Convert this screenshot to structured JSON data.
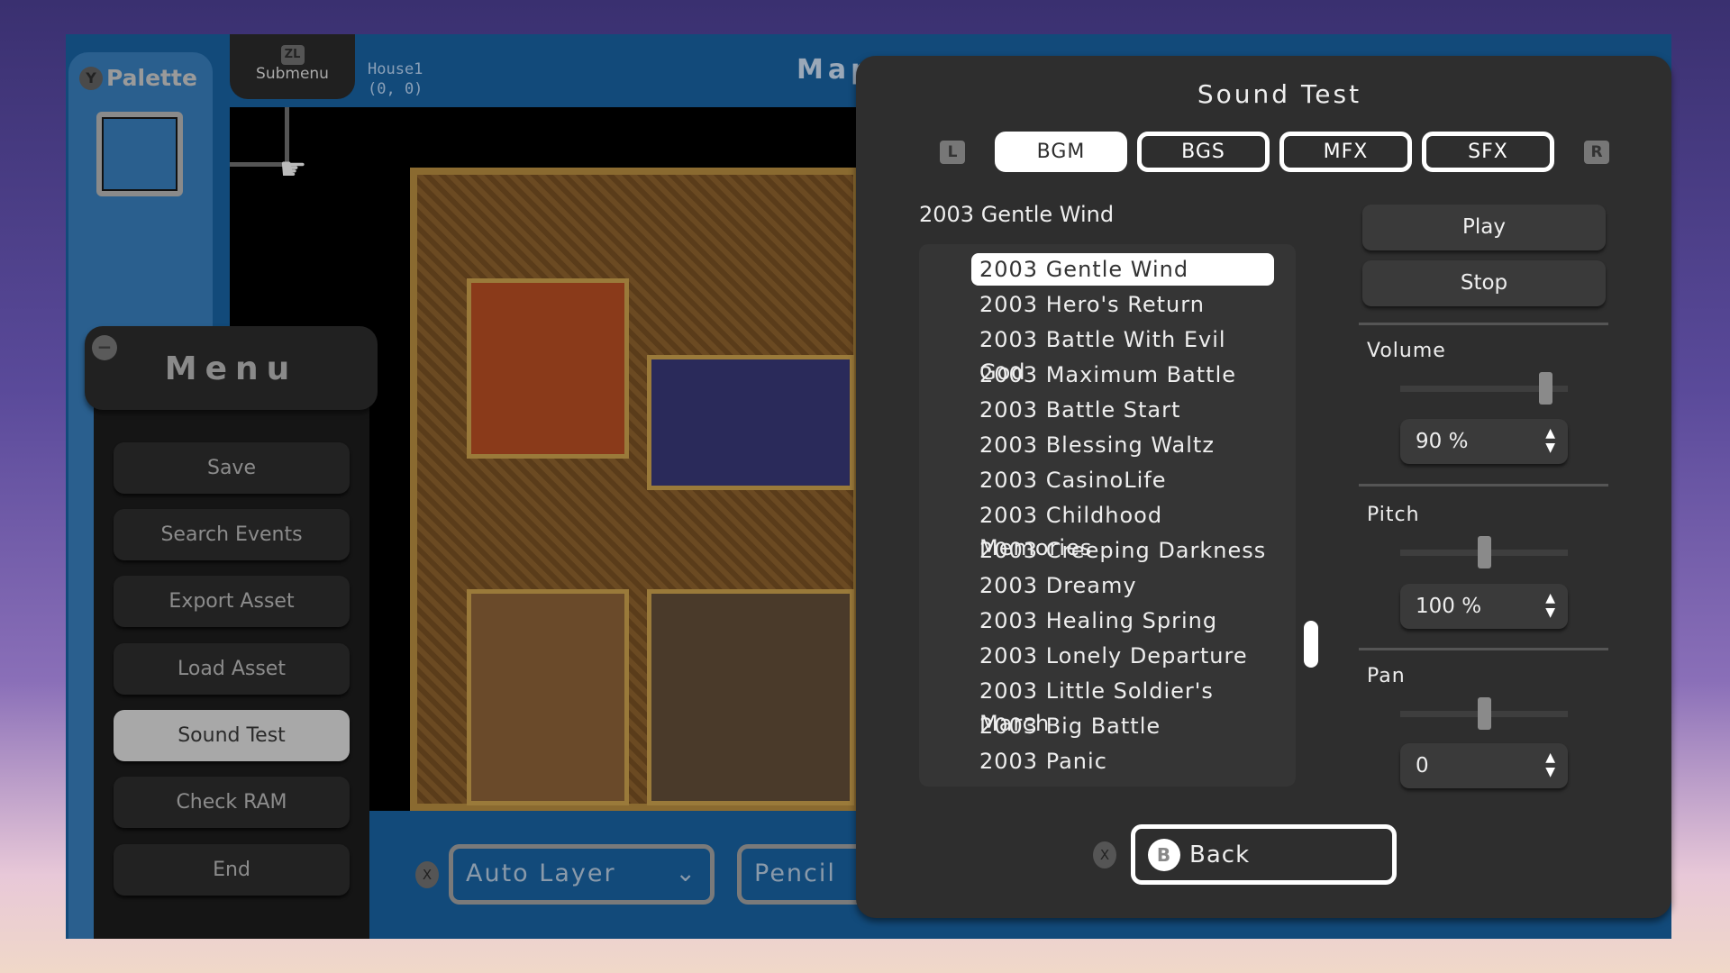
{
  "palette": {
    "button": "Y",
    "title": "Palette"
  },
  "submenu": {
    "button": "ZL",
    "label": "Submenu"
  },
  "map_info": {
    "name": "House1",
    "coords": "(0, 0)",
    "title": "Map"
  },
  "toolbar": {
    "x_button": "X",
    "layer_value": "Auto Layer",
    "tool_value": "Pencil"
  },
  "menu": {
    "minus": "−",
    "title": "Menu",
    "items": [
      {
        "label": "Save"
      },
      {
        "label": "Search Events"
      },
      {
        "label": "Export Asset"
      },
      {
        "label": "Load Asset"
      },
      {
        "label": "Sound Test",
        "active": true
      },
      {
        "label": "Check RAM"
      },
      {
        "label": "End"
      }
    ]
  },
  "sound_test": {
    "title": "Sound Test",
    "l_button": "L",
    "r_button": "R",
    "tabs": [
      {
        "label": "BGM",
        "selected": true
      },
      {
        "label": "BGS"
      },
      {
        "label": "MFX"
      },
      {
        "label": "SFX"
      }
    ],
    "current": "2003 Gentle Wind",
    "tracks": [
      "2003 Gentle Wind",
      "2003 Hero's Return",
      "2003 Battle With Evil God",
      "2003 Maximum Battle",
      "2003 Battle Start",
      "2003 Blessing Waltz",
      "2003 CasinoLife",
      "2003 Childhood Memories",
      "2003 Creeping Darkness",
      "2003 Dreamy",
      "2003 Healing Spring",
      "2003 Lonely Departure",
      "2003 Little Soldier's March",
      "2003 Big Battle",
      "2003 Panic"
    ],
    "play": "Play",
    "stop": "Stop",
    "volume": {
      "label": "Volume",
      "value": "90 %",
      "slider_fraction": 0.9
    },
    "pitch": {
      "label": "Pitch",
      "value": "100 %",
      "slider_fraction": 0.5
    },
    "pan": {
      "label": "Pan",
      "value": "0",
      "slider_fraction": 0.5
    },
    "x_button": "X",
    "back_button": "B",
    "back": "Back"
  },
  "colors": {
    "frame": "#124a7a",
    "panel": "#2e2e2e",
    "accent": "#ffffff"
  }
}
